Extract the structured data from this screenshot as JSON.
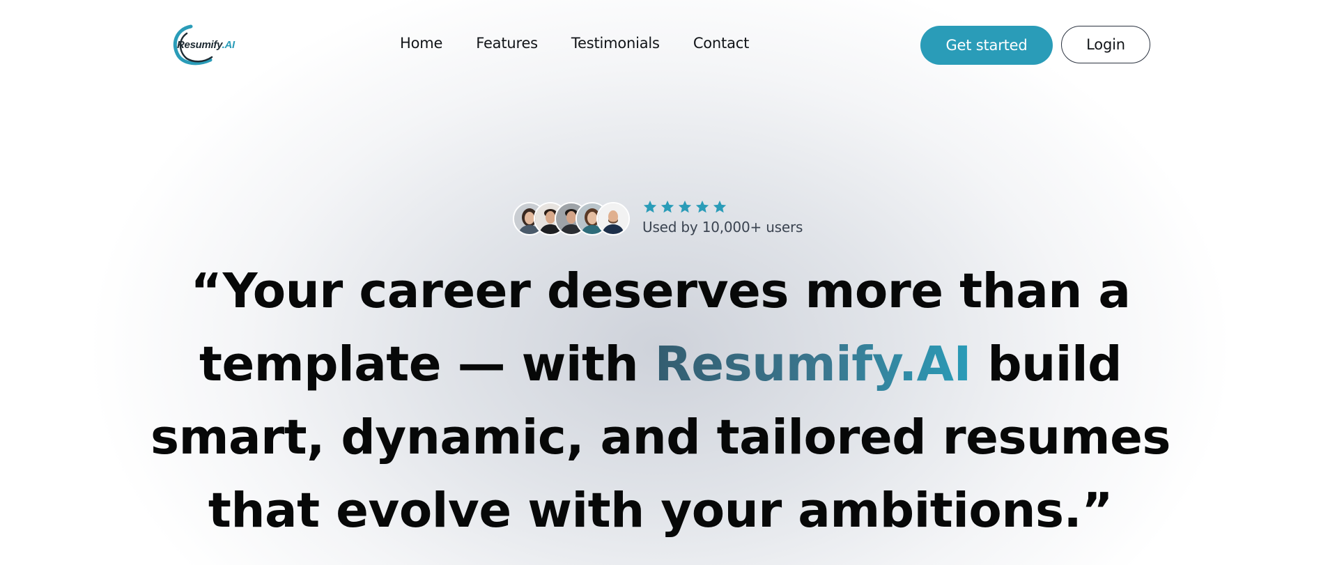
{
  "brand": {
    "name": "Resumify",
    "suffix": ".AI",
    "accent_color": "#2a9cb8"
  },
  "nav": {
    "items": [
      {
        "label": "Home"
      },
      {
        "label": "Features"
      },
      {
        "label": "Testimonials"
      },
      {
        "label": "Contact"
      }
    ]
  },
  "actions": {
    "primary_label": "Get started",
    "secondary_label": "Login"
  },
  "social_proof": {
    "rating": 5,
    "rating_max": 5,
    "star_icon": "star-icon",
    "star_color": "#2a9cb8",
    "users_text": "Used by 10,000+ users",
    "avatar_count": 5
  },
  "hero": {
    "line1": "“Your career deserves more than a",
    "line2_prefix": "template — with ",
    "line2_brand": "Resumify.AI",
    "line2_suffix": " build",
    "line3": "smart, dynamic, and tailored resumes",
    "line4": "that evolve with your ambitions.”"
  }
}
